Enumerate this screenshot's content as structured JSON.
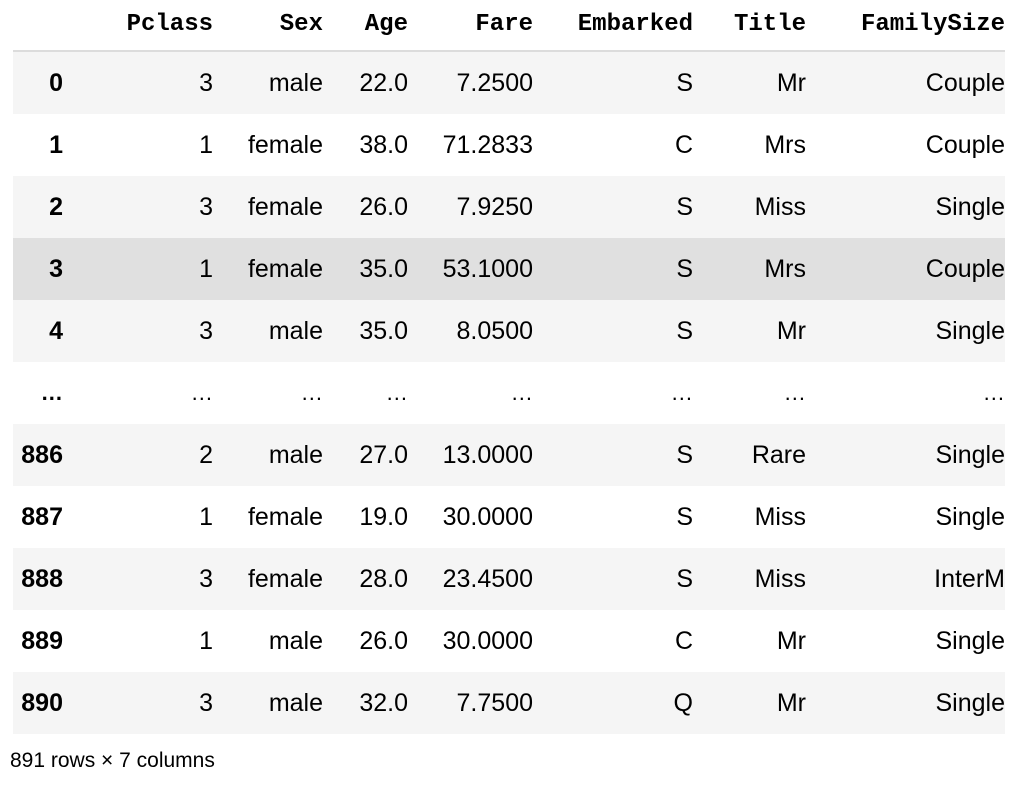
{
  "table": {
    "index_header": "",
    "columns": [
      "Pclass",
      "Sex",
      "Age",
      "Fare",
      "Embarked",
      "Title",
      "FamilySize"
    ],
    "rows": [
      {
        "index": "0",
        "style": "stripe",
        "cells": [
          "3",
          "male",
          "22.0",
          "7.2500",
          "S",
          "Mr",
          "Couple"
        ]
      },
      {
        "index": "1",
        "style": "plain",
        "cells": [
          "1",
          "female",
          "38.0",
          "71.2833",
          "C",
          "Mrs",
          "Couple"
        ]
      },
      {
        "index": "2",
        "style": "stripe",
        "cells": [
          "3",
          "female",
          "26.0",
          "7.9250",
          "S",
          "Miss",
          "Single"
        ]
      },
      {
        "index": "3",
        "style": "hover",
        "cells": [
          "1",
          "female",
          "35.0",
          "53.1000",
          "S",
          "Mrs",
          "Couple"
        ]
      },
      {
        "index": "4",
        "style": "stripe",
        "cells": [
          "3",
          "male",
          "35.0",
          "8.0500",
          "S",
          "Mr",
          "Single"
        ]
      },
      {
        "index": "...",
        "style": "ellipsis",
        "cells": [
          "...",
          "...",
          "...",
          "...",
          "...",
          "...",
          "..."
        ]
      },
      {
        "index": "886",
        "style": "stripe",
        "cells": [
          "2",
          "male",
          "27.0",
          "13.0000",
          "S",
          "Rare",
          "Single"
        ]
      },
      {
        "index": "887",
        "style": "plain",
        "cells": [
          "1",
          "female",
          "19.0",
          "30.0000",
          "S",
          "Miss",
          "Single"
        ]
      },
      {
        "index": "888",
        "style": "stripe",
        "cells": [
          "3",
          "female",
          "28.0",
          "23.4500",
          "S",
          "Miss",
          "InterM"
        ]
      },
      {
        "index": "889",
        "style": "plain",
        "cells": [
          "1",
          "male",
          "26.0",
          "30.0000",
          "C",
          "Mr",
          "Single"
        ]
      },
      {
        "index": "890",
        "style": "stripe",
        "cells": [
          "3",
          "male",
          "32.0",
          "7.7500",
          "Q",
          "Mr",
          "Single"
        ]
      }
    ],
    "footer": "891 rows × 7 columns"
  },
  "colors": {
    "stripe": "#f5f5f5",
    "plain": "#ffffff",
    "hover": "#e0e0e0",
    "rule": "#dcdcdc",
    "text": "#000000",
    "background": "#ffffff"
  }
}
